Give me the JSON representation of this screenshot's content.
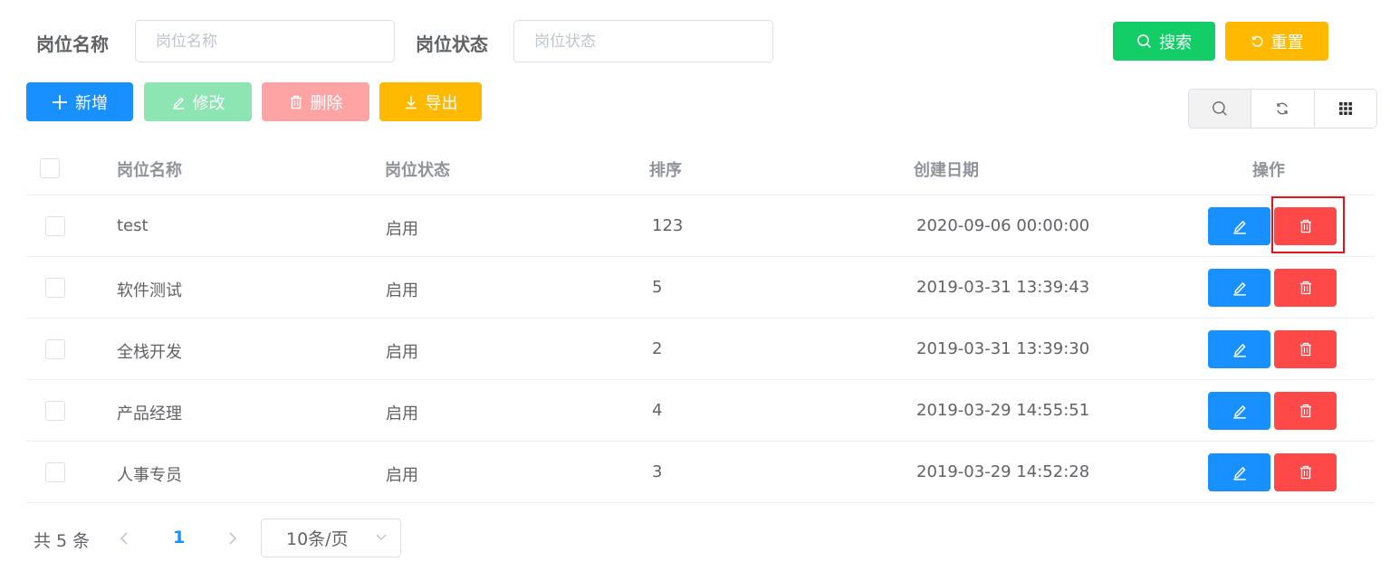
{
  "search": {
    "post_name_label": "岗位名称",
    "post_name_placeholder": "岗位名称",
    "post_status_label": "岗位状态",
    "post_status_placeholder": "岗位状态",
    "search_button": "搜索",
    "reset_button": "重置"
  },
  "toolbar": {
    "add_label": "新增",
    "edit_label": "修改",
    "delete_label": "删除",
    "export_label": "导出",
    "icons": [
      "search-icon",
      "refresh-icon",
      "columns-grid-icon"
    ]
  },
  "table": {
    "columns": [
      "岗位名称",
      "岗位状态",
      "排序",
      "创建日期",
      "操作"
    ],
    "rows": [
      {
        "name": "test",
        "status": "启用",
        "sort": "123",
        "created": "2020-09-06 00:00:00"
      },
      {
        "name": "软件测试",
        "status": "启用",
        "sort": "5",
        "created": "2019-03-31 13:39:43"
      },
      {
        "name": "全栈开发",
        "status": "启用",
        "sort": "2",
        "created": "2019-03-31 13:39:30"
      },
      {
        "name": "产品经理",
        "status": "启用",
        "sort": "4",
        "created": "2019-03-29 14:55:51"
      },
      {
        "name": "人事专员",
        "status": "启用",
        "sort": "3",
        "created": "2019-03-29 14:52:28"
      }
    ]
  },
  "pagination": {
    "total": "共 5 条",
    "current_page": "1",
    "page_size": "10条/页"
  },
  "colors": {
    "primary": "#1890ff",
    "success": "#13ce66",
    "warning": "#ffba00",
    "danger": "#ff4949",
    "highlight": "#e0141c"
  }
}
